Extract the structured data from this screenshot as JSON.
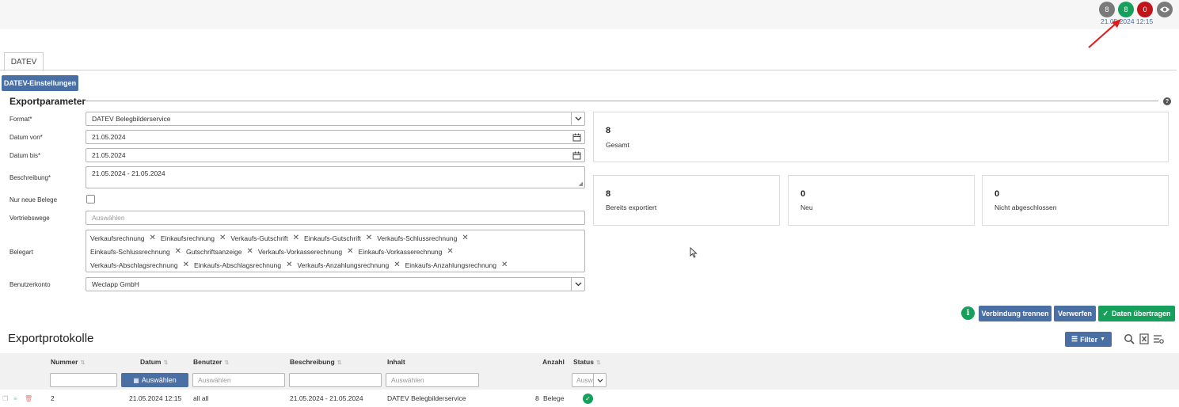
{
  "header": {
    "badge_gray": "8",
    "badge_green": "8",
    "badge_red": "0",
    "timestamp": "21.05.2024 12:15",
    "colors": {
      "gray": "#7a7a7a",
      "green": "#16a05c",
      "red": "#c0161b",
      "arrow": "#e01b1b"
    }
  },
  "tabs": [
    {
      "label": "DATEV"
    }
  ],
  "settings_button": "DATEV-Einstellungen",
  "export_params": {
    "title": "Exportparameter",
    "format_label": "Format*",
    "format_value": "DATEV Belegbilderservice",
    "datum_von_label": "Datum von*",
    "datum_von_value": "21.05.2024",
    "datum_bis_label": "Datum bis*",
    "datum_bis_value": "21.05.2024",
    "beschreibung_label": "Beschreibung*",
    "beschreibung_value": "21.05.2024 - 21.05.2024",
    "nur_neue_label": "Nur neue Belege",
    "vertriebswege_label": "Vertriebswege",
    "vertriebswege_placeholder": "Auswählen",
    "belegart_label": "Belegart",
    "belegart_chips": [
      "Verkaufsrechnung",
      "Einkaufsrechnung",
      "Verkaufs-Gutschrift",
      "Einkaufs-Gutschrift",
      "Verkaufs-Schlussrechnung",
      "Einkaufs-Schlussrechnung",
      "Gutschriftsanzeige",
      "Verkaufs-Vorkasserechnung",
      "Einkaufs-Vorkasserechnung",
      "Verkaufs-Abschlagsrechnung",
      "Einkaufs-Abschlagsrechnung",
      "Verkaufs-Anzahlungsrechnung",
      "Einkaufs-Anzahlungsrechnung"
    ],
    "benutzerkonto_label": "Benutzerkonto",
    "benutzerkonto_value": "Weclapp GmbH"
  },
  "stats": {
    "gesamt_num": "8",
    "gesamt_label": "Gesamt",
    "exportiert_num": "8",
    "exportiert_label": "Bereits exportiert",
    "neu_num": "0",
    "neu_label": "Neu",
    "nicht_num": "0",
    "nicht_label": "Nicht abgeschlossen"
  },
  "actions": {
    "trennen": "Verbindung trennen",
    "verwerfen": "Verwerfen",
    "uebertragen": "Daten übertragen"
  },
  "protokolle": {
    "title": "Exportprotokolle",
    "filter_button": "Filter",
    "columns": {
      "nummer": "Nummer",
      "datum": "Datum",
      "benutzer": "Benutzer",
      "beschreibung": "Beschreibung",
      "inhalt": "Inhalt",
      "anzahl": "Anzahl",
      "status": "Status"
    },
    "datum_filter_button": "Auswählen",
    "benutzer_filter_placeholder": "Auswählen",
    "inhalt_filter_placeholder": "Auswählen",
    "status_filter_value": "Ausw",
    "row": {
      "nummer": "2",
      "datum": "21.05.2024 12:15",
      "benutzer": "all all",
      "beschreibung": "21.05.2024 - 21.05.2024",
      "inhalt": "DATEV Belegbilderservice",
      "anzahl": "8",
      "anzahl_unit": "Belege"
    }
  }
}
